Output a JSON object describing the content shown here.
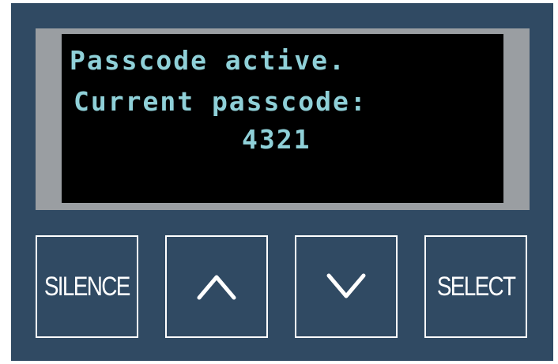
{
  "display": {
    "line1": "Passcode active.",
    "line2": "Current passcode:",
    "line3": "4321",
    "text_color": "#8fd0d8",
    "background_color": "#000000"
  },
  "buttons": {
    "silence_label": "SILENCE",
    "up_icon": "chevron-up-icon",
    "down_icon": "chevron-down-icon",
    "select_label": "SELECT"
  },
  "colors": {
    "panel": "#304a63",
    "bezel": "#9a9ea2",
    "button_border": "#ffffff"
  }
}
